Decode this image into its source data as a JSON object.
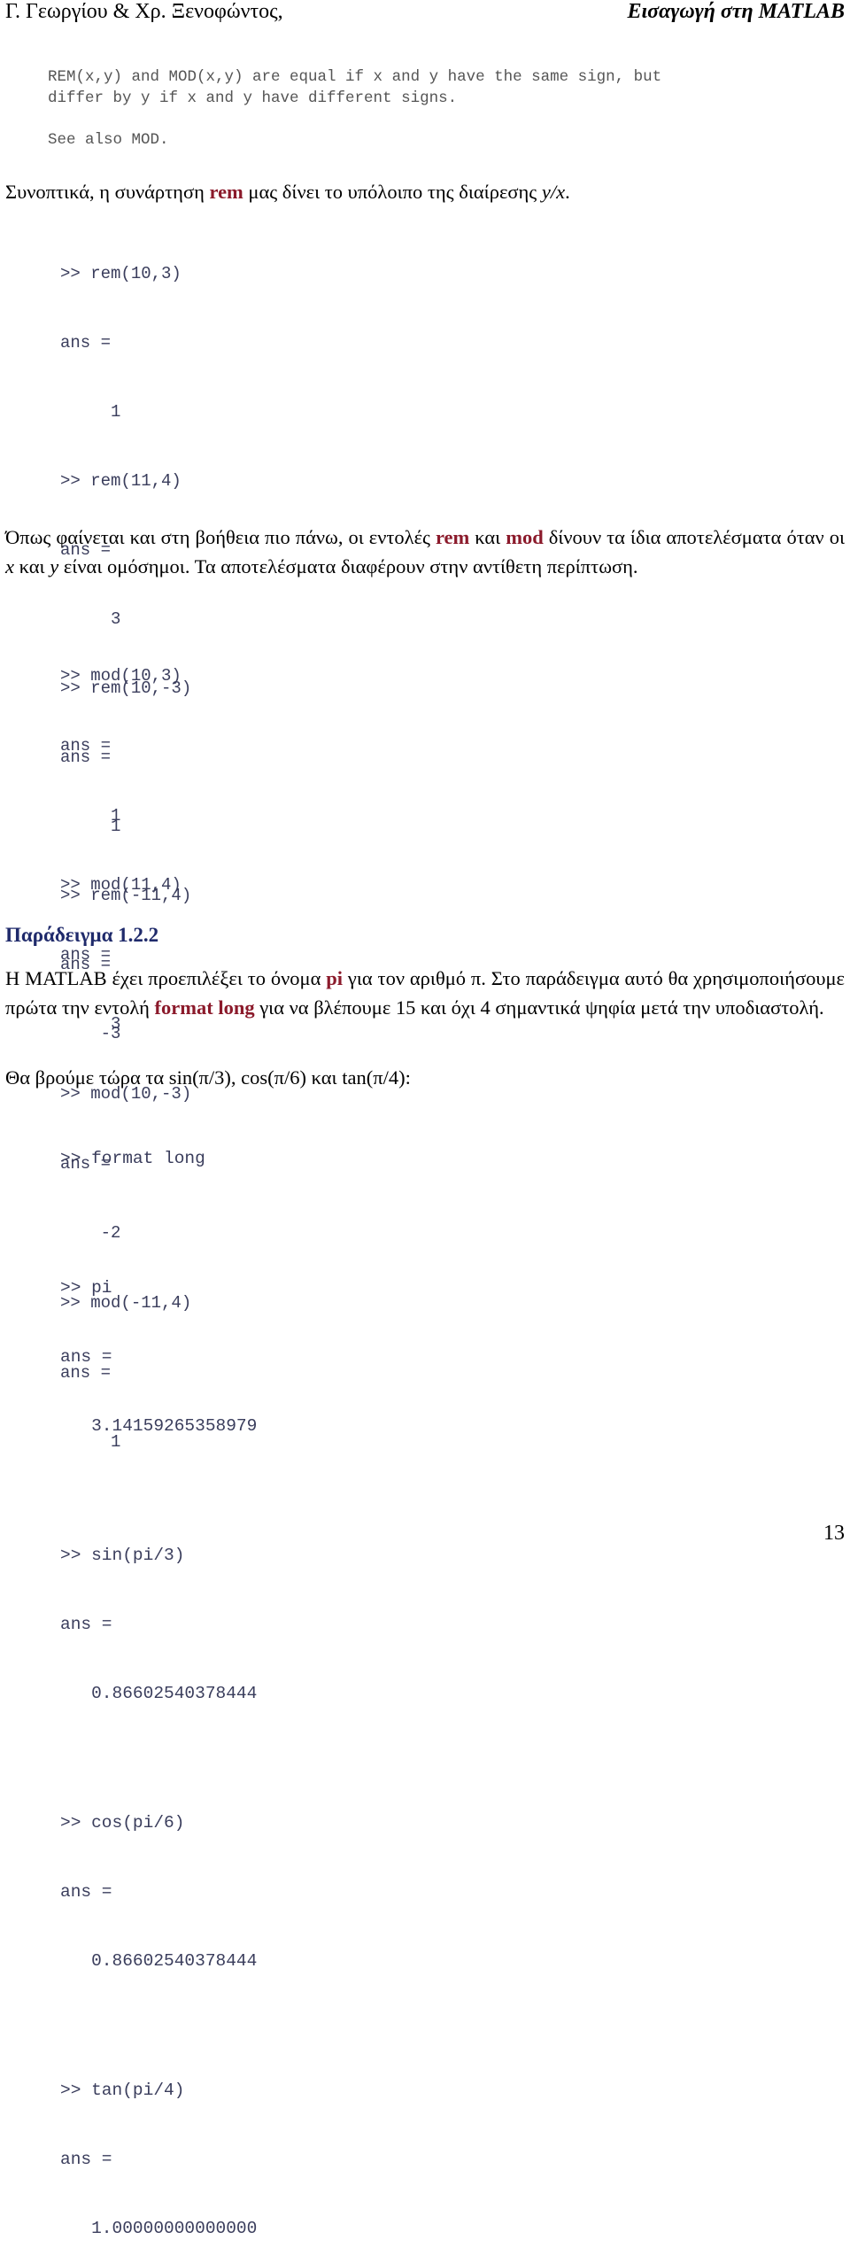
{
  "header": {
    "authors": "Γ. Γεωργίου & Χρ. Ξενοφώντος,",
    "book_title": "Εισαγωγή στη MATLAB"
  },
  "help_text": {
    "lines": [
      "REM(x,y) and MOD(x,y) are equal if x and y have the same sign, but",
      "differ by y if x and y have different signs.",
      "",
      "See also MOD."
    ]
  },
  "para1": {
    "before": "Συνοπτικά, η συνάρτηση ",
    "keyword": "rem",
    "after": " μας δίνει το υπόλοιπο της διαίρεσης ",
    "expr": "y/x",
    "end": "."
  },
  "rem_session": {
    "lines": [
      ">> rem(10,3)",
      "ans =",
      "     1",
      ">> rem(11,4)",
      "ans =",
      "     3",
      ">> rem(10,-3)",
      "ans =",
      "     1",
      ">> rem(-11,4)",
      "ans =",
      "    -3"
    ]
  },
  "para2": {
    "t1": "Όπως φαίνεται και στη βοήθεια πιο πάνω, οι εντολές ",
    "kw1": "rem",
    "t2": " και ",
    "kw2": "mod",
    "t3": " δίνουν τα ίδια αποτελέσματα όταν οι ",
    "x": "x",
    "t4": " και ",
    "y": "y",
    "t5": " είναι ομόσημοι. Τα αποτελέσματα διαφέρουν στην αντίθετη περίπτωση."
  },
  "mod_session": {
    "lines": [
      ">> mod(10,3)",
      "ans =",
      "     1",
      ">> mod(11,4)",
      "ans =",
      "     3",
      ">> mod(10,-3)",
      "ans =",
      "    -2",
      ">> mod(-11,4)",
      "ans =",
      "     1"
    ]
  },
  "example": {
    "heading": "Παράδειγμα 1.2.2",
    "p1_t1": "Η MATLAB έχει προεπιλέξει το όνομα ",
    "p1_kw1": "pi",
    "p1_t2": " για τον αριθμό π. Στο παράδειγμα αυτό θα χρησιμοποιήσουμε πρώτα την εντολή ",
    "p1_kw2": "format long",
    "p1_t3": " για να βλέπουμε 15 και όχι 4 σημαντικά ψηφία μετά την υποδιαστολή.",
    "p2": "Θα βρούμε τώρα τα sin(π/3), cos(π/6) και tan(π/4):"
  },
  "trig_session": {
    "blocks": [
      {
        "cmd": ">> format long"
      },
      {
        "cmd": ">> pi",
        "ans": "ans =",
        "val": "   3.14159265358979"
      },
      {
        "cmd": ">> sin(pi/3)",
        "ans": "ans =",
        "val": "   0.86602540378444"
      },
      {
        "cmd": ">> cos(pi/6)",
        "ans": "ans =",
        "val": "   0.86602540378444"
      },
      {
        "cmd": ">> tan(pi/4)",
        "ans": "ans =",
        "val": "   1.00000000000000"
      }
    ]
  },
  "page_number": "13",
  "colors": {
    "keyword": "#8b1a2b",
    "heading": "#1f2a6b",
    "code": "#3a3d5c"
  }
}
